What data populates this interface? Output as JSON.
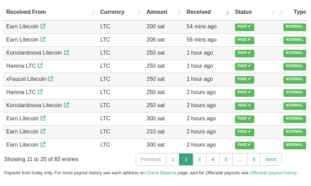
{
  "table": {
    "headers": {
      "received_from": "Received From",
      "currency": "Currency",
      "amount": "Amount",
      "received": "Received",
      "status": "Status",
      "type": "Type"
    },
    "rows": [
      {
        "from": "Earn Litecoin",
        "currency": "LTC",
        "amount": "200 sat",
        "received": "54 mins ago",
        "status": "PAID",
        "type": "NORMAL"
      },
      {
        "from": "Earn Litecoin",
        "currency": "LTC",
        "amount": "206 sat",
        "received": "56 mins ago",
        "status": "PAID",
        "type": "NORMAL"
      },
      {
        "from": "Konstantinova Litecoin",
        "currency": "LTC",
        "amount": "250 sat",
        "received": "1 hour ago",
        "status": "PAID",
        "type": "NORMAL"
      },
      {
        "from": "Harena LTC",
        "currency": "LTC",
        "amount": "250 sat",
        "received": "1 hour ago",
        "status": "PAID",
        "type": "NORMAL"
      },
      {
        "from": "xFaucet Litecoin",
        "currency": "LTC",
        "amount": "250 sat",
        "received": "1 hour ago",
        "status": "PAID",
        "type": "NORMAL"
      },
      {
        "from": "Harena LTC",
        "currency": "LTC",
        "amount": "250 sat",
        "received": "2 hours ago",
        "status": "PAID",
        "type": "NORMAL"
      },
      {
        "from": "Konstantinova Litecoin",
        "currency": "LTC",
        "amount": "250 sat",
        "received": "2 hours ago",
        "status": "PAID",
        "type": "NORMAL"
      },
      {
        "from": "Earn Litecoin",
        "currency": "LTC",
        "amount": "300 sat",
        "received": "2 hours ago",
        "status": "PAID",
        "type": "NORMAL"
      },
      {
        "from": "Earn Litecoin",
        "currency": "LTC",
        "amount": "210 sat",
        "received": "2 hours ago",
        "status": "PAID",
        "type": "NORMAL"
      },
      {
        "from": "Earn Litecoin",
        "currency": "LTC",
        "amount": "300 sat",
        "received": "2 hours ago",
        "status": "PAID",
        "type": "NORMAL"
      }
    ]
  },
  "info": "Showing 11 to 20 of 83 entries",
  "pagination": {
    "previous": "Previous",
    "pages": [
      "1",
      "2",
      "3",
      "4",
      "5",
      "...",
      "9"
    ],
    "current": "2",
    "next": "Next"
  },
  "note": {
    "part1": "Payouts from today only. For more payout history see each address on ",
    "link1": "Check Balance",
    "part2": " page, and for Offerwall payouts see ",
    "link2": "Offerwall payout history",
    "part3": "."
  },
  "colors": {
    "accent": "#3aa37b",
    "badge": "#5cb85c"
  },
  "icons": {
    "external_link": "external-link-icon",
    "check": "check-icon",
    "sort": "sort-icon"
  }
}
